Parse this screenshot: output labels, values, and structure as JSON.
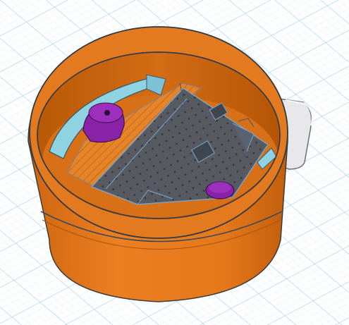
{
  "workplane": {
    "grid_color": "#8fc8e8",
    "grid_minor_color": "#cfe6f5",
    "background": "#ffffff"
  },
  "model": {
    "cup_color": "#e6781c",
    "cup_dark": "#c45f0c",
    "cup_rim_inner": "#b25406",
    "holder_color": "#8fd3e3",
    "board_color": "#4f5560",
    "board_edge_color": "#3d4450",
    "peg_color": "#8a22a8",
    "shell_color": "#e8e8ea",
    "icons": [
      "cup-body-icon",
      "arduino-board-icon",
      "bracket-icon",
      "mount-peg-icon",
      "side-shell-icon"
    ]
  }
}
